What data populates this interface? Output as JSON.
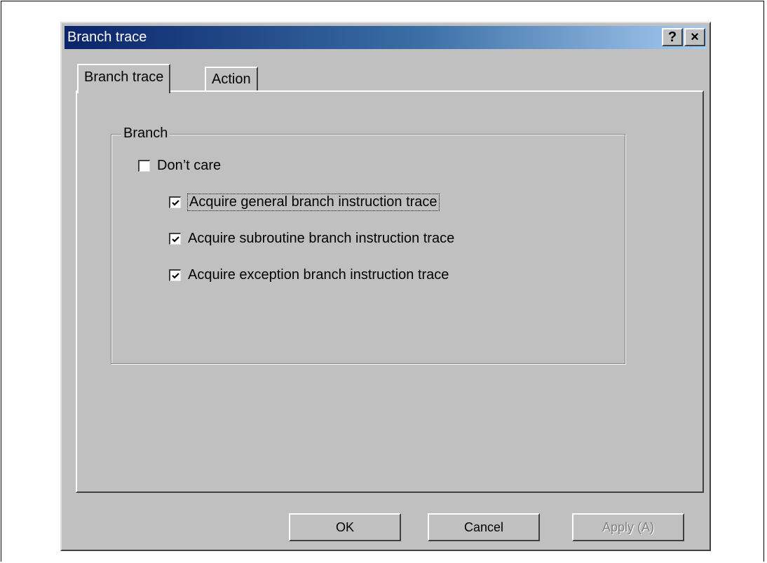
{
  "dialog": {
    "title": "Branch trace",
    "help_glyph": "?",
    "close_glyph": "×"
  },
  "tabs": [
    {
      "label": "Branch trace",
      "active": true
    },
    {
      "label": "Action",
      "active": false
    }
  ],
  "group": {
    "label": "Branch",
    "dont_care": {
      "label": "Don’t care",
      "checked": false
    },
    "options": [
      {
        "label": "Acquire general branch instruction trace",
        "checked": true
      },
      {
        "label": "Acquire subroutine branch instruction trace",
        "checked": true
      },
      {
        "label": "Acquire exception branch instruction trace",
        "checked": true
      }
    ]
  },
  "buttons": {
    "ok": "OK",
    "cancel": "Cancel",
    "apply": "Apply (A)"
  },
  "icons": {
    "help": "help-icon",
    "close": "close-icon",
    "check": "check-icon"
  },
  "colors": {
    "titlebar_start": "#0a246a",
    "titlebar_end": "#a6caf0",
    "face": "#c0c0c0"
  }
}
